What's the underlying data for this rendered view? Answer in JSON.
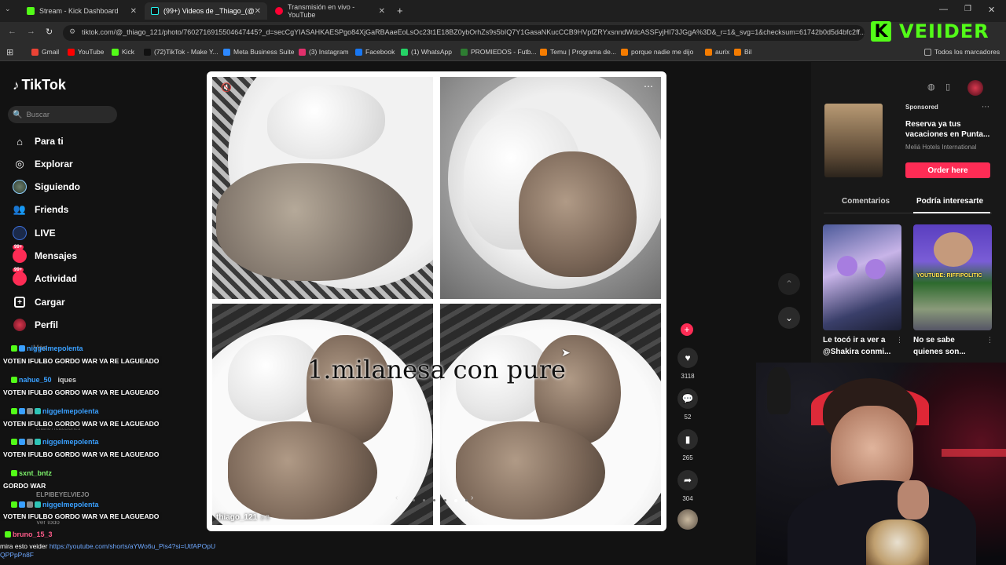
{
  "browser": {
    "tabs": [
      {
        "label": "Stream - Kick Dashboard",
        "active": false
      },
      {
        "label": "(99+) Videos de _Thiago_(@_th",
        "active": true
      },
      {
        "label": "Transmisión en vivo - YouTube",
        "active": false
      }
    ],
    "new_tab": "+",
    "url": "tiktok.com/@_thiago_121/photo/7602716915504647445?_d=secCgYIASAHKAESPgo84XjGaRBAaeEoLsOc23t1E18BZ0ybOrhZs9s5bIQ7Y1GasaNKucCCB9HVpfZRYxsnndWdcASSFyjHI73JGgA%3D&_r=1&_svg=1&checksum=61742b0d5d4bfc2ff...",
    "bookmarks": [
      "Gmail",
      "YouTube",
      "Kick",
      "(72)TikTok - Make Y...",
      "Meta Business Suite",
      "(3) Instagram",
      "Facebook",
      "(1) WhatsApp",
      "PROMIEDOS - Futb...",
      "Temu | Programa de...",
      "porque nadie me dijo",
      "aurix",
      "Bil"
    ],
    "all_bookmarks": "Todos los marcadores",
    "bookmark_colors": [
      "#ea4335",
      "#ff0000",
      "#53fc18",
      "#111111",
      "#2d88ff",
      "#e1306c",
      "#1877f2",
      "#25d366",
      "#2e7d32",
      "#f57c00",
      "#f57c00",
      "#f57c00",
      "#f57c00"
    ]
  },
  "kick_logo": {
    "mark": "K",
    "text": "VEIIDER"
  },
  "tiktok": {
    "logo": "TikTok",
    "search_placeholder": "Buscar",
    "nav": [
      {
        "label": "Para ti",
        "icon": "home-icon"
      },
      {
        "label": "Explorar",
        "icon": "compass-icon"
      },
      {
        "label": "Siguiendo",
        "icon": "following-avatar-icon"
      },
      {
        "label": "Friends",
        "icon": "friends-icon"
      },
      {
        "label": "LIVE",
        "icon": "live-icon"
      },
      {
        "label": "Mensajes",
        "icon": "messages-icon",
        "badge": "99+"
      },
      {
        "label": "Actividad",
        "icon": "activity-icon",
        "badge": "99+"
      },
      {
        "label": "Cargar",
        "icon": "upload-icon"
      },
      {
        "label": "Perfil",
        "icon": "profile-icon"
      }
    ],
    "post": {
      "caption": "1.milanesa con pure",
      "author": "thiago_121",
      "counter": "2-3",
      "likes": "3118",
      "comments": "52",
      "saves": "265",
      "shares": "304"
    },
    "right": {
      "sponsored_label": "Sponsored",
      "ad_title": "Reserva ya tus vacaciones en Punta...",
      "ad_brand": "Meliá Hotels International",
      "ad_button": "Order here",
      "tab_comments": "Comentarios",
      "tab_interest": "Podría interesarte",
      "cards": [
        {
          "caption": "Le tocó ir a ver a @Shakira conmi..."
        },
        {
          "caption": "No se sabe quienes son...",
          "overlay": "YOUTUBE: RIFFIPOLITIC"
        }
      ]
    }
  },
  "chat": {
    "lines": [
      {
        "user": "",
        "text": "VOTEN IFULBO GORDO WAR VA RE LAGUEADO"
      },
      {
        "user": "nahue_50",
        "text": "iques"
      },
      {
        "user": "",
        "text": "VOTEN IFULBO GORDO WAR VA RE LAGUEADO"
      },
      {
        "user": "niggelmepolenta",
        "text": ""
      },
      {
        "user": "",
        "text": "VOTEN IFULBO GORDO WAR VA RE LAGUEADO"
      },
      {
        "user": "niggelmepolenta",
        "text": ""
      },
      {
        "user": "",
        "text": "VOTEN IFULBO GORDO WAR VA RE LAGUEADO"
      },
      {
        "user": "sxnt_bntz",
        "text": ""
      },
      {
        "user": "",
        "text": "GORDO WAR"
      },
      {
        "user": "niggelmepolenta",
        "text": ""
      },
      {
        "user": "",
        "text": "VOTEN IFULBO GORDO WAR VA RE LAGUEADO"
      },
      {
        "user": "bruno_15_3",
        "text": ""
      }
    ],
    "ghost": {
      "more": "Más",
      "reacciones": "elian07reacciones",
      "elpibe": "ELPIBEYELVIEJO",
      "vertodo": "Ver todo"
    },
    "top_user": "niggelmepolenta",
    "last_text": "mira esto veider",
    "last_link": "https://youtube.com/shorts/aYWo6u_Pis4?si=UtfAPOpUQPPpPn8F"
  }
}
